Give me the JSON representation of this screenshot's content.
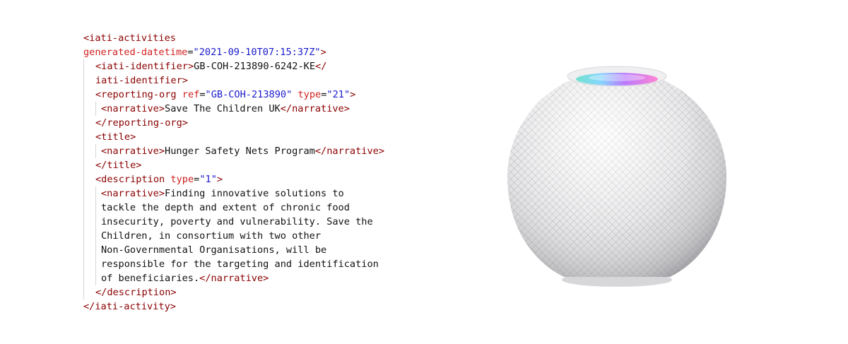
{
  "code": {
    "line1": "<iati-activities",
    "line2_attr": "generated-datetime",
    "line2_eq": "=",
    "line2_val": "\"2021-09-10T07:15:37Z\"",
    "line2_close": ">",
    "line3_open": "<iati-identifier>",
    "line3_text": "GB-COH-213890-6242-KE",
    "line3_close": "</",
    "line4": "iati-identifier>",
    "line5_open": "<reporting-org",
    "line5_attr1": "ref",
    "line5_eq1": "=",
    "line5_val1": "\"GB-COH-213890\"",
    "line5_attr2": "type",
    "line5_eq2": "=",
    "line5_val2": "\"21\"",
    "line5_close": ">",
    "line6_open": "<narrative>",
    "line6_text": "Save The Children UK",
    "line6_close": "</narrative>",
    "line7": "</reporting-org>",
    "line8": "<title>",
    "line9_open": "<narrative>",
    "line9_text": "Hunger Safety Nets Program",
    "line9_close": "</narrative>",
    "line10": "</title>",
    "line11_open": "<description",
    "line11_attr": "type",
    "line11_eq": "=",
    "line11_val": "\"1\"",
    "line11_close": ">",
    "line12_open": "<narrative>",
    "line12_text": "Finding innovative solutions to",
    "line13": "tackle the depth and extent of chronic food",
    "line14": "insecurity, poverty and vulnerability. Save the",
    "line15": "Children, in consortium with two other",
    "line16": "Non-Governmental Organisations, will be",
    "line17": "responsible for the targeting and identification",
    "line18_text": "of beneficiaries.",
    "line18_close": "</narrative>",
    "line19": "</description>",
    "line20": "</iati-activity>"
  },
  "image": {
    "icon": "smart-speaker-icon",
    "body_color": "#e9e9eb",
    "glow_colors": [
      "#7ad3ff",
      "#b56cff",
      "#ff7ad0",
      "#66e0c9"
    ]
  }
}
